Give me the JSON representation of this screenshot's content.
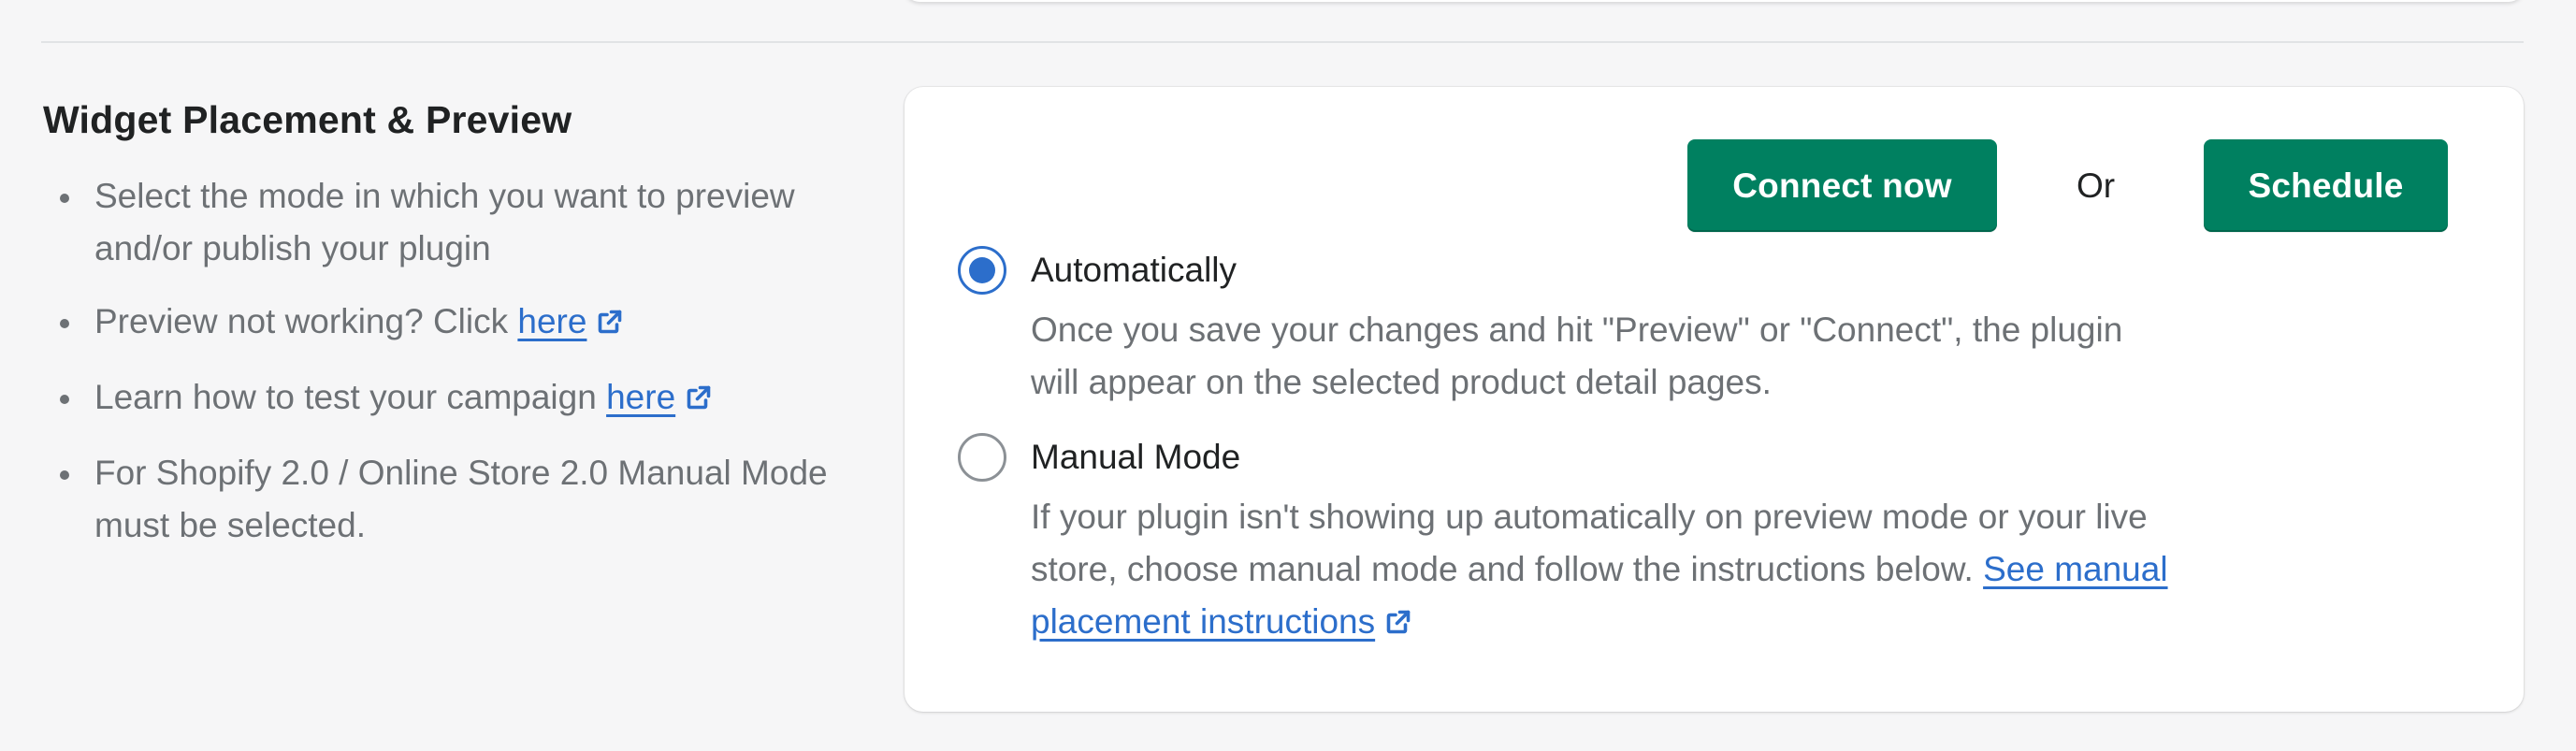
{
  "section": {
    "title": "Widget Placement & Preview",
    "help_items": [
      {
        "text": "Select the mode in which you want to preview and/or publish your plugin"
      },
      {
        "text": "Preview not working? Click ",
        "link": "here"
      },
      {
        "text": "Learn how to test your campaign ",
        "link": "here"
      },
      {
        "text": "For Shopify 2.0 / Online Store 2.0 Manual Mode must be selected."
      }
    ]
  },
  "actions": {
    "connect_label": "Connect now",
    "or_label": "Or",
    "schedule_label": "Schedule"
  },
  "placement_mode": {
    "selected": "automatically",
    "options": [
      {
        "label": "Automatically",
        "description": "Once you save your changes and hit \"Preview\" or \"Connect\", the plugin will appear on the selected product detail pages."
      },
      {
        "label": "Manual Mode",
        "description": "If your plugin isn't showing up automatically on preview mode or your live store, choose manual mode and follow the instructions below. ",
        "link": "See manual placement instructions"
      }
    ]
  },
  "colors": {
    "primary_button": "#008060",
    "link": "#2c6ecb",
    "radio_selected": "#2c6ecb",
    "muted_text": "#6d7175"
  },
  "icons": {
    "external_link": "external-link-icon"
  }
}
